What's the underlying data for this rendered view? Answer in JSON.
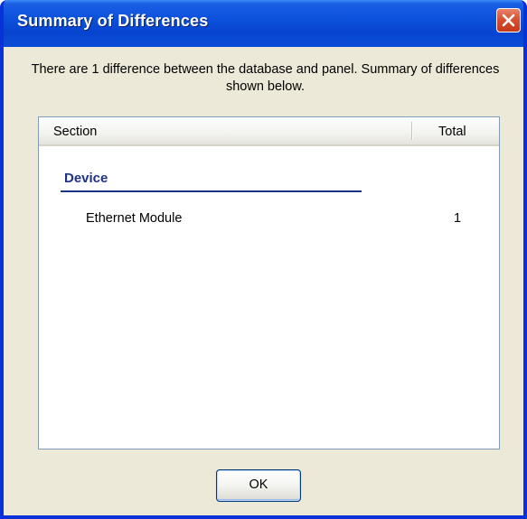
{
  "window": {
    "title": "Summary of Differences",
    "close_icon": "close-icon"
  },
  "message": "There are 1 difference between the database and panel. Summary of differences shown below.",
  "list": {
    "columns": {
      "section": "Section",
      "total": "Total"
    },
    "groups": [
      {
        "label": "Device",
        "rows": [
          {
            "name": "Ethernet Module",
            "total": "1"
          }
        ]
      }
    ]
  },
  "buttons": {
    "ok": "OK"
  },
  "colors": {
    "titlebar": "#0a4fd9",
    "window_bg": "#ece9d8",
    "group_label": "#1e3287",
    "close_button": "#d9502f"
  }
}
